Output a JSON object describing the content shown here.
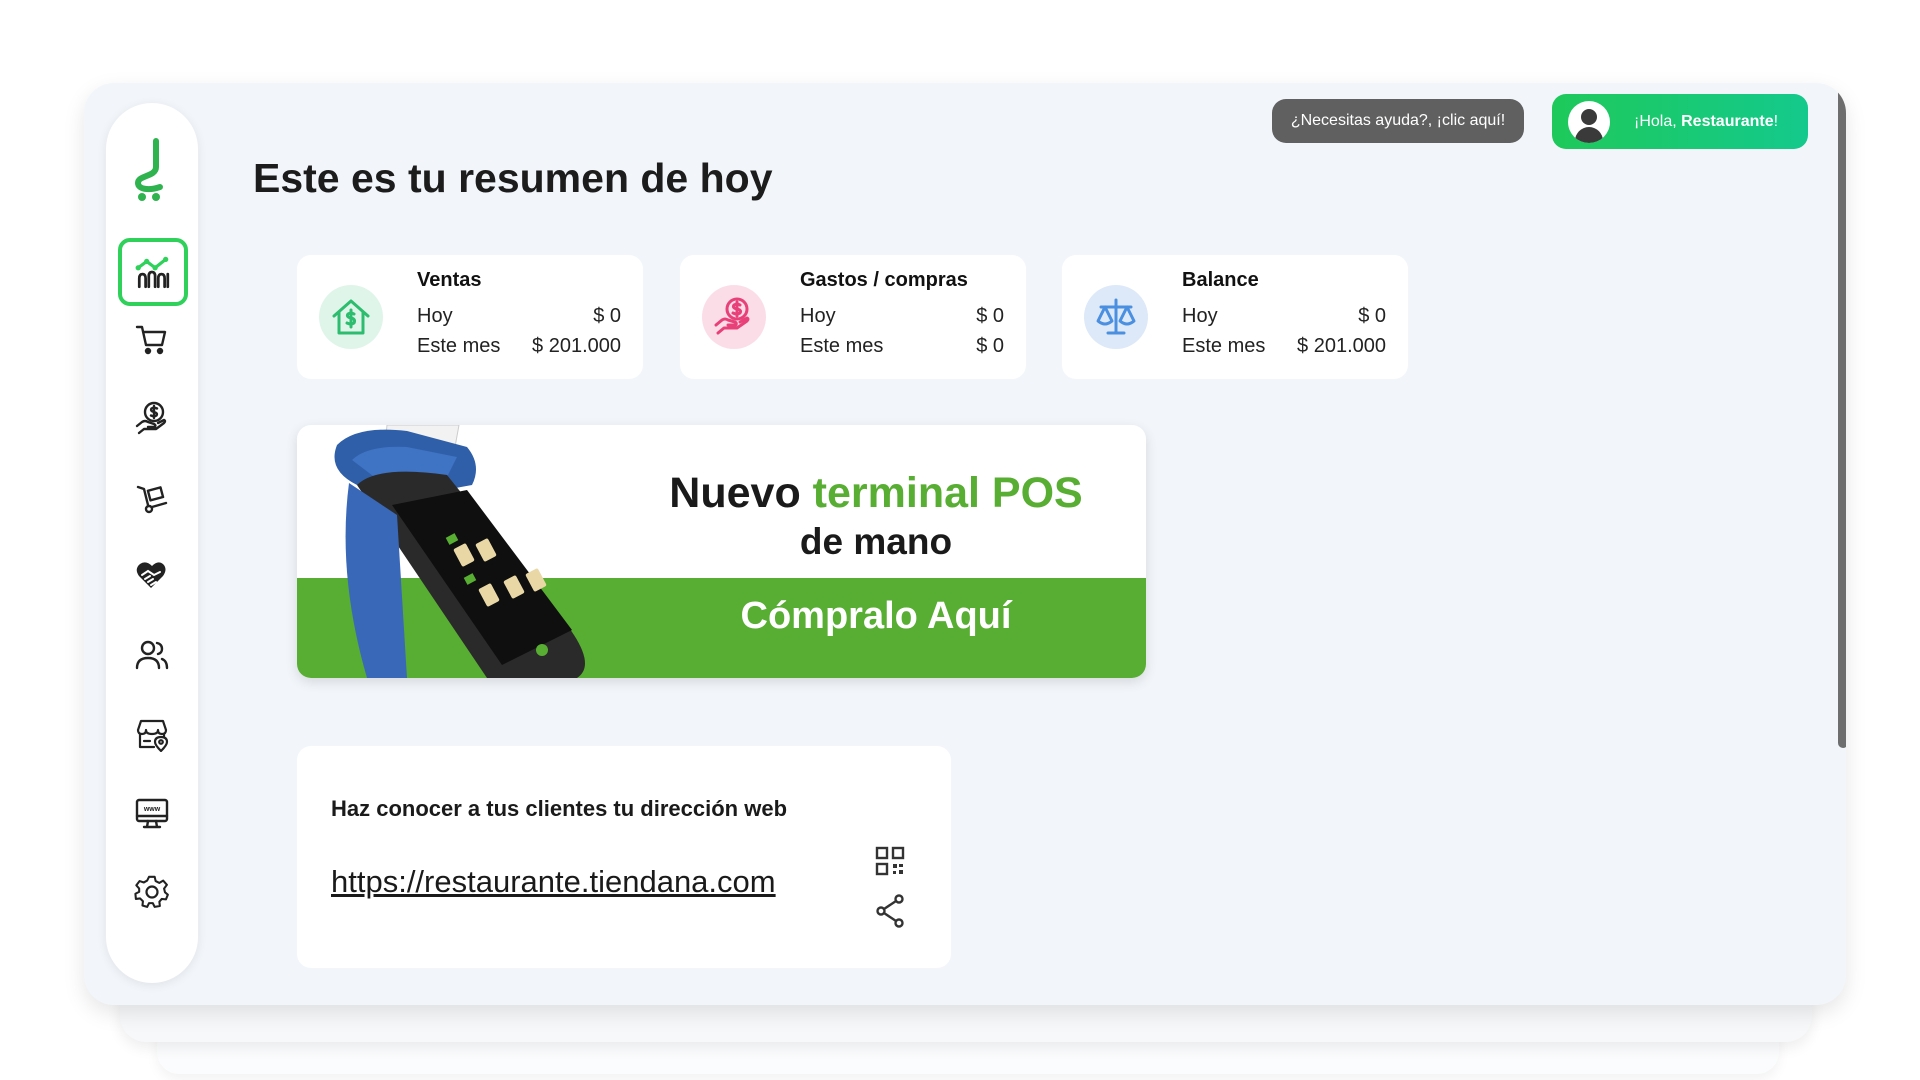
{
  "header": {
    "help_label": "¿Necesitas ayuda?, ¡clic aquí!",
    "greeting_prefix": "¡Hola, ",
    "user_name": "Restaurante",
    "greeting_suffix": "!"
  },
  "page_title": "Este es tu resumen de hoy",
  "sidebar": {
    "logo": "tiendana-logo",
    "items": [
      {
        "icon": "dashboard-chart-icon",
        "active": true
      },
      {
        "icon": "cart-icon"
      },
      {
        "icon": "money-hand-icon"
      },
      {
        "icon": "hand-truck-icon"
      },
      {
        "icon": "handshake-icon"
      },
      {
        "icon": "users-icon"
      },
      {
        "icon": "store-location-icon"
      },
      {
        "icon": "website-monitor-icon"
      },
      {
        "icon": "settings-gear-icon"
      }
    ]
  },
  "summary_cards": [
    {
      "title": "Ventas",
      "icon": "house-dollar-icon",
      "color": "#2dbd6e",
      "today_label": "Hoy",
      "today_value": "$ 0",
      "month_label": "Este mes",
      "month_value": "$ 201.000"
    },
    {
      "title": "Gastos / compras",
      "icon": "hand-coin-icon",
      "color": "#e8417a",
      "today_label": "Hoy",
      "today_value": "$ 0",
      "month_label": "Este mes",
      "month_value": "$ 0"
    },
    {
      "title": "Balance",
      "icon": "scale-icon",
      "color": "#4a8fe0",
      "today_label": "Hoy",
      "today_value": "$ 0",
      "month_label": "Este mes",
      "month_value": "$ 201.000"
    }
  ],
  "banner": {
    "line1_part1": "Nuevo ",
    "line1_highlight": "terminal POS",
    "line2": "de mano",
    "cta": "Cómpralo Aquí",
    "accent_color": "#58ae32"
  },
  "web_card": {
    "heading": "Haz conocer a tus clientes tu dirección web",
    "url": "https://restaurante.tiendana.com",
    "qr_icon": "qr-code-icon",
    "share_icon": "share-icon"
  },
  "colors": {
    "brand_green": "#2fd15b",
    "background": "#f2f6fa"
  }
}
